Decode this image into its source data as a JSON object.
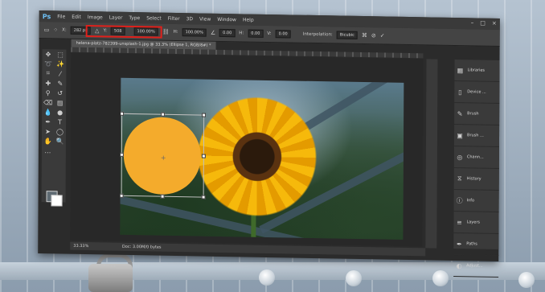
{
  "app": {
    "logo": "Ps",
    "menu": [
      "File",
      "Edit",
      "Image",
      "Layer",
      "Type",
      "Select",
      "Filter",
      "3D",
      "View",
      "Window",
      "Help"
    ],
    "window_controls": [
      "–",
      "□",
      "×"
    ]
  },
  "options_bar": {
    "x_label": "X:",
    "x_value": "282 px",
    "y_label": "Y:",
    "y_value": "508",
    "w_value": "100.00%",
    "h_label": "H:",
    "h_value": "100.00%",
    "angle_value": "0.00",
    "h_skew_label": "H:",
    "h_skew_value": "0.00",
    "v_skew_label": "V:",
    "v_skew_value": "0.00",
    "interpolation_label": "Interpolation:",
    "interpolation_value": "Bicubic",
    "highlight_color": "#e0201b"
  },
  "document": {
    "tab_label": "helena-platz-782399-unsplash-1.jpg @ 33.3% (Ellipse 1, RGB/8#) *",
    "zoom": "33.33%",
    "doc_info": "Doc: 3.00M/0 bytes"
  },
  "panels": [
    {
      "label": "Libraries",
      "icon": "libraries-icon"
    },
    {
      "label": "Device ...",
      "icon": "device-icon"
    },
    {
      "label": "Brush",
      "icon": "brush-icon"
    },
    {
      "label": "Brush ...",
      "icon": "brush-presets-icon"
    },
    {
      "label": "Chann...",
      "icon": "channels-icon"
    },
    {
      "label": "History",
      "icon": "history-icon"
    },
    {
      "label": "Info",
      "icon": "info-icon"
    },
    {
      "label": "Layers",
      "icon": "layers-icon"
    },
    {
      "label": "Paths",
      "icon": "paths-icon"
    },
    {
      "label": "Adjust...",
      "icon": "adjustments-icon"
    }
  ],
  "colors": {
    "ellipse_fill": "#f4ab2c",
    "app_bg": "#2b2b2b",
    "ps_blue": "#6ec0f5"
  }
}
